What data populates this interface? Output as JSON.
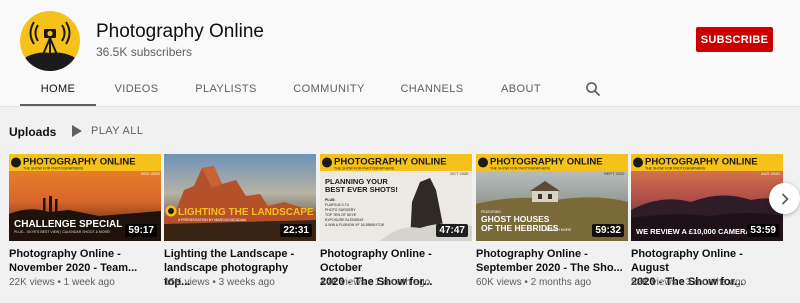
{
  "channel": {
    "name": "Photography Online",
    "subscribers": "36.5K subscribers",
    "subscribe_label": "SUBSCRIBE",
    "avatar_icon": "tripod-camera-logo-icon",
    "accent": "#cc0000"
  },
  "tabs": [
    {
      "label": "HOME",
      "active": true
    },
    {
      "label": "VIDEOS",
      "active": false
    },
    {
      "label": "PLAYLISTS",
      "active": false
    },
    {
      "label": "COMMUNITY",
      "active": false
    },
    {
      "label": "CHANNELS",
      "active": false
    },
    {
      "label": "ABOUT",
      "active": false
    }
  ],
  "search_icon": "search-icon",
  "uploads": {
    "title": "Uploads",
    "play_all_label": "PLAY ALL"
  },
  "videos": [
    {
      "title_line1": "Photography Online -",
      "title_line2": "November 2020 - Team...",
      "meta": "22K views • 1 week ago",
      "duration": "59:17",
      "thumb_brand": "PHOTOGRAPHY ONLINE",
      "thumb_tagline": "THE SHOW FOR PHOTOGRAPHERS",
      "thumb_date": "NOV 2020",
      "thumb_headline": "CHALLENGE SPECIAL",
      "thumb_subline": "PLUS... SKYE'S BEST VIEW | CALENDAR SHOOT & MORE!"
    },
    {
      "title_line1": "Lighting the Landscape -",
      "title_line2": "landscape photography top...",
      "meta": "15K views • 3 weeks ago",
      "duration": "22:31",
      "thumb_headline": "LIGHTING THE LANDSCAPE",
      "thumb_subline": "A PRESENTATION BY MARCUS MCADAM"
    },
    {
      "title_line1": "Photography Online - October",
      "title_line2": "2020 - The Show for...",
      "meta": "44K views • 1 month ago",
      "duration": "47:47",
      "thumb_brand": "PHOTOGRAPHY ONLINE",
      "thumb_tagline": "THE SHOW FOR PHOTOGRAPHERS",
      "thumb_date": "OCT 2020",
      "thumb_headline_1": "PLANNING YOUR",
      "thumb_headline_2": "BEST EVER SHOTS!",
      "thumb_list_head": "PLUS:",
      "thumb_list": [
        "FUJIFILM X-T4",
        "PHOTO SURGERY",
        "TOP TEN OF SKYE",
        "EXPOSURE BLENDING",
        "& WIN A FUJINON XF 16-55MM F2.8!"
      ]
    },
    {
      "title_line1": "Photography Online -",
      "title_line2": "September 2020 - The Sho...",
      "meta": "60K views • 2 months ago",
      "duration": "59:32",
      "thumb_brand": "PHOTOGRAPHY ONLINE",
      "thumb_tagline": "THE SHOW FOR PHOTOGRAPHERS",
      "thumb_date": "SEPT 2020",
      "thumb_kicker": "FEATURING",
      "thumb_headline_1": "GHOST HOUSES",
      "thumb_headline_2": "OF THE HEBRIDES",
      "thumb_subline": "& MUCH MORE"
    },
    {
      "title_line1": "Photography Online - August",
      "title_line2": "2020 - The Show for...",
      "meta": "58K views • 3 months ago",
      "duration": "53:59",
      "thumb_brand": "PHOTOGRAPHY ONLINE",
      "thumb_tagline": "THE SHOW FOR PHOTOGRAPHERS",
      "thumb_date": "AUG 2020",
      "thumb_headline": "WE REVIEW A £10,000 CAMERA"
    }
  ],
  "next_icon": "chevron-right-icon"
}
